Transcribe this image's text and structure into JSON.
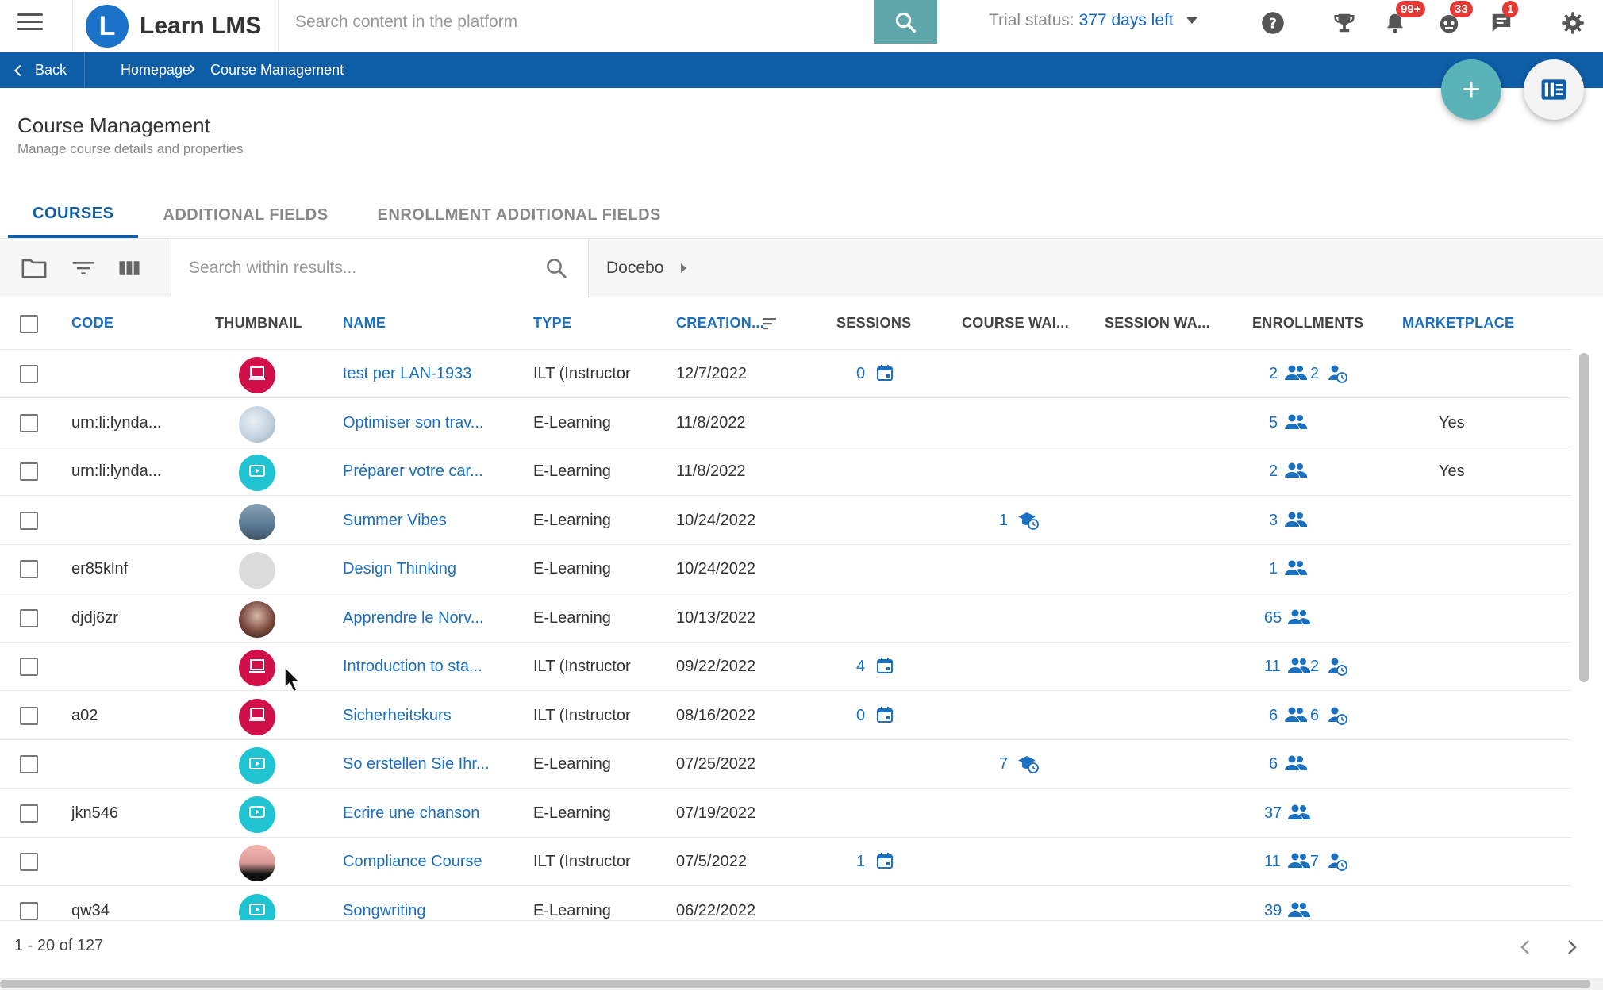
{
  "header": {
    "app_name": "Learn LMS",
    "logo_letter": "L",
    "search_placeholder": "Search content in the platform",
    "trial_label": "Trial status:",
    "trial_days": "377 days left",
    "badges": {
      "notifications": "99+",
      "chat_bot": "33",
      "messages": "1"
    }
  },
  "breadcrumb": {
    "back": "Back",
    "home": "Homepage",
    "current": "Course Management"
  },
  "page": {
    "title": "Course Management",
    "subtitle": "Manage course details and properties"
  },
  "tabs": [
    {
      "label": "COURSES",
      "active": true
    },
    {
      "label": "ADDITIONAL FIELDS",
      "active": false
    },
    {
      "label": "ENROLLMENT ADDITIONAL FIELDS",
      "active": false
    }
  ],
  "toolbar": {
    "search_placeholder": "Search within results...",
    "branch": "Docebo"
  },
  "columns": {
    "code": "CODE",
    "thumbnail": "THUMBNAIL",
    "name": "NAME",
    "type": "TYPE",
    "creation": "CREATION...",
    "sessions": "SESSIONS",
    "course_wait": "COURSE WAI...",
    "session_wait": "SESSION WA...",
    "enrollments": "ENROLLMENTS",
    "marketplace": "MARKETPLACE"
  },
  "rows": [
    {
      "code": "",
      "thumb": "ilt",
      "name": "test per LAN-1933",
      "type": "ILT (Instructor",
      "date": "12/7/2022",
      "sessions": "0",
      "course_wait": "",
      "enrollments": "2",
      "waiting": "2",
      "marketplace": ""
    },
    {
      "code": "urn:li:lynda...",
      "thumb": "img-a",
      "name": "Optimiser son trav...",
      "type": "E-Learning",
      "date": "11/8/2022",
      "sessions": "",
      "course_wait": "",
      "enrollments": "5",
      "waiting": "",
      "marketplace": "Yes"
    },
    {
      "code": "urn:li:lynda...",
      "thumb": "elearn",
      "name": "Préparer votre car...",
      "type": "E-Learning",
      "date": "11/8/2022",
      "sessions": "",
      "course_wait": "",
      "enrollments": "2",
      "waiting": "",
      "marketplace": "Yes"
    },
    {
      "code": "",
      "thumb": "img-b",
      "name": "Summer Vibes",
      "type": "E-Learning",
      "date": "10/24/2022",
      "sessions": "",
      "course_wait": "1",
      "enrollments": "3",
      "waiting": "",
      "marketplace": ""
    },
    {
      "code": "er85klnf",
      "thumb": "img-c",
      "name": "Design Thinking",
      "type": "E-Learning",
      "date": "10/24/2022",
      "sessions": "",
      "course_wait": "",
      "enrollments": "1",
      "waiting": "",
      "marketplace": ""
    },
    {
      "code": "djdj6zr",
      "thumb": "img-d",
      "name": "Apprendre le Norv...",
      "type": "E-Learning",
      "date": "10/13/2022",
      "sessions": "",
      "course_wait": "",
      "enrollments": "65",
      "waiting": "",
      "marketplace": ""
    },
    {
      "code": "",
      "thumb": "ilt",
      "name": "Introduction to sta...",
      "type": "ILT (Instructor",
      "date": "09/22/2022",
      "sessions": "4",
      "course_wait": "",
      "enrollments": "11",
      "waiting": "2",
      "marketplace": ""
    },
    {
      "code": "a02",
      "thumb": "ilt",
      "name": "Sicherheitskurs",
      "type": "ILT (Instructor",
      "date": "08/16/2022",
      "sessions": "0",
      "course_wait": "",
      "enrollments": "6",
      "waiting": "6",
      "marketplace": ""
    },
    {
      "code": "",
      "thumb": "elearn",
      "name": "So erstellen Sie Ihr...",
      "type": "E-Learning",
      "date": "07/25/2022",
      "sessions": "",
      "course_wait": "7",
      "enrollments": "6",
      "waiting": "",
      "marketplace": ""
    },
    {
      "code": "jkn546",
      "thumb": "elearn",
      "name": "Ecrire une chanson",
      "type": "E-Learning",
      "date": "07/19/2022",
      "sessions": "",
      "course_wait": "",
      "enrollments": "37",
      "waiting": "",
      "marketplace": ""
    },
    {
      "code": "",
      "thumb": "img-e",
      "name": "Compliance Course",
      "type": "ILT (Instructor",
      "date": "07/5/2022",
      "sessions": "1",
      "course_wait": "",
      "enrollments": "11",
      "waiting": "7",
      "marketplace": ""
    },
    {
      "code": "qw34",
      "thumb": "elearn",
      "name": "Songwriting",
      "type": "E-Learning",
      "date": "06/22/2022",
      "sessions": "",
      "course_wait": "",
      "enrollments": "39",
      "waiting": "",
      "marketplace": ""
    }
  ],
  "footer": {
    "range": "1 - 20 of 127"
  },
  "colors": {
    "primary": "#0e5ea7",
    "link": "#1a6fbf",
    "accent": "#5ab3b8",
    "ilt": "#d1104a",
    "elearning": "#1fc3d1",
    "badge": "#e53935"
  }
}
